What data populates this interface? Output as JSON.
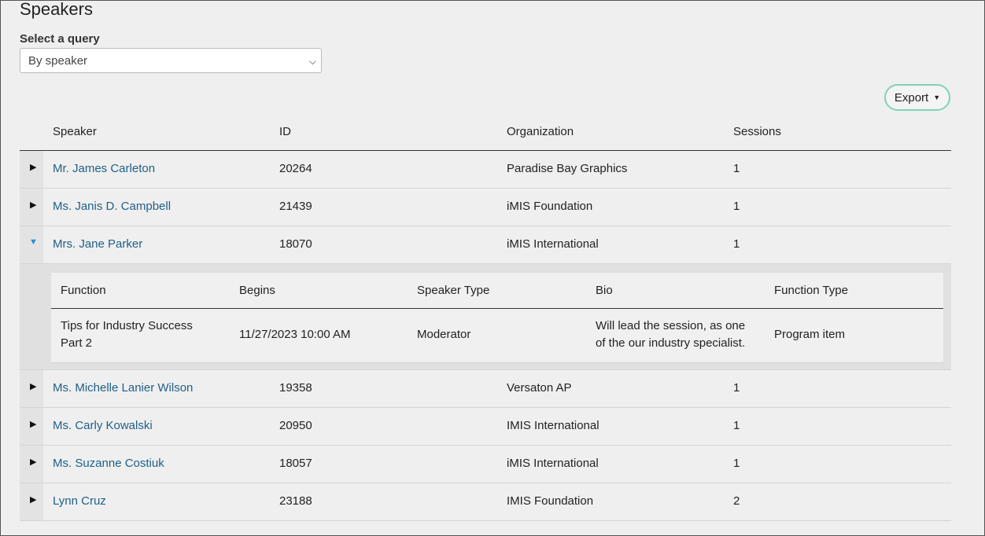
{
  "page": {
    "title": "Speakers"
  },
  "query": {
    "label": "Select a query",
    "selected": "By speaker"
  },
  "export": {
    "label": "Export"
  },
  "table": {
    "headers": {
      "speaker": "Speaker",
      "id": "ID",
      "organization": "Organization",
      "sessions": "Sessions"
    },
    "rows": [
      {
        "name": "Mr. James Carleton",
        "id": "20264",
        "org": "Paradise Bay Graphics",
        "sessions": "1"
      },
      {
        "name": "Ms. Janis D. Campbell",
        "id": "21439",
        "org": "iMIS Foundation",
        "sessions": "1"
      },
      {
        "name": "Mrs. Jane Parker",
        "id": "18070",
        "org": "iMIS International",
        "sessions": "1"
      },
      {
        "name": "Ms. Michelle Lanier Wilson",
        "id": "19358",
        "org": "Versaton AP",
        "sessions": "1"
      },
      {
        "name": "Ms. Carly Kowalski",
        "id": "20950",
        "org": "IMIS International",
        "sessions": "1"
      },
      {
        "name": "Ms. Suzanne Costiuk",
        "id": "18057",
        "org": "iMIS International",
        "sessions": "1"
      },
      {
        "name": "Lynn Cruz",
        "id": "23188",
        "org": "IMIS Foundation",
        "sessions": "2"
      }
    ]
  },
  "detail": {
    "headers": {
      "function": "Function",
      "begins": "Begins",
      "speaker_type": "Speaker Type",
      "bio": "Bio",
      "function_type": "Function Type"
    },
    "row": {
      "function_line1": "Tips for Industry Success",
      "function_line2": "Part 2",
      "begins": "11/27/2023 10:00 AM",
      "speaker_type": "Moderator",
      "bio_line1": "Will lead the session, as one",
      "bio_line2": "of the our industry specialist.",
      "function_type": "Program item"
    }
  },
  "icons": {
    "collapsed": "triangle-right-icon",
    "expanded": "triangle-down-icon",
    "select": "chevron-down-icon",
    "export": "caret-down-icon"
  },
  "colors": {
    "link": "#1f5f86",
    "expanded_toggle": "#2a8fd0",
    "export_border": "#7fd3b8"
  }
}
